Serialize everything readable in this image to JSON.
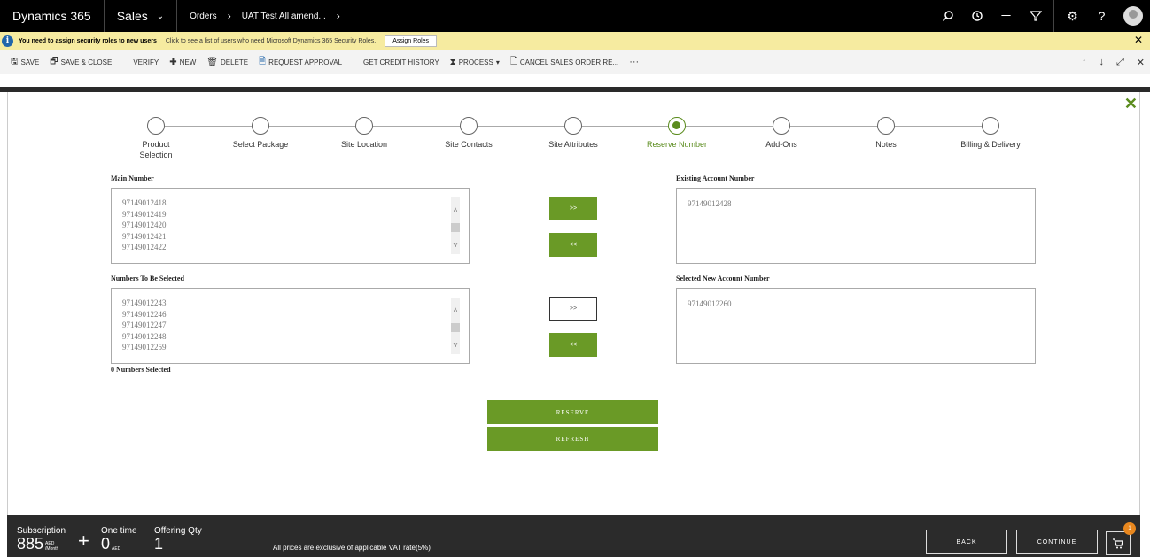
{
  "nav": {
    "brand": "Dynamics 365",
    "app": "Sales",
    "breadcrumb": [
      "Orders",
      "UAT Test All amend..."
    ]
  },
  "notification": {
    "title": "You need to assign security roles to new users",
    "message": "Click to see a list of users who need Microsoft Dynamics 365 Security Roles.",
    "button": "Assign Roles"
  },
  "commands": [
    {
      "label": "SAVE",
      "icon": "save-icon"
    },
    {
      "label": "SAVE & CLOSE",
      "icon": "save-close-icon"
    },
    {
      "label": "VERIFY",
      "icon": ""
    },
    {
      "label": "NEW",
      "icon": "plus-icon"
    },
    {
      "label": "DELETE",
      "icon": "trash-icon"
    },
    {
      "label": "REQUEST APPROVAL",
      "icon": "document-icon"
    },
    {
      "label": "GET CREDIT HISTORY",
      "icon": ""
    },
    {
      "label": "PROCESS",
      "icon": "process-icon"
    },
    {
      "label": "CANCEL SALES ORDER RE...",
      "icon": "cancel-doc-icon"
    }
  ],
  "steps": [
    {
      "label": "Product Selection",
      "active": false
    },
    {
      "label": "Select Package",
      "active": false
    },
    {
      "label": "Site Location",
      "active": false
    },
    {
      "label": "Site Contacts",
      "active": false
    },
    {
      "label": "Site Attributes",
      "active": false
    },
    {
      "label": "Reserve Number",
      "active": true
    },
    {
      "label": "Add-Ons",
      "active": false
    },
    {
      "label": "Notes",
      "active": false
    },
    {
      "label": "Billing & Delivery",
      "active": false
    }
  ],
  "main_number": {
    "label": "Main Number",
    "items": [
      "97149012418",
      "97149012419",
      "97149012420",
      "97149012421",
      "97149012422"
    ]
  },
  "existing_account": {
    "label": "Existing Account Number",
    "value": "97149012428"
  },
  "numbers_to_select": {
    "label": "Numbers To Be Selected",
    "items": [
      "97149012243",
      "97149012246",
      "97149012247",
      "97149012248",
      "97149012259"
    ],
    "count_label": "0 Numbers Selected"
  },
  "selected_new_account": {
    "label": "Selected New Account Number",
    "value": "97149012260"
  },
  "arrows": {
    "right": ">>",
    "left": "<<"
  },
  "actions": {
    "reserve": "RESERVE",
    "refresh": "REFRESH"
  },
  "footer": {
    "subscription_label": "Subscription",
    "subscription_value": "885",
    "subscription_unit_1": "AED",
    "subscription_unit_2": "/Month",
    "onetime_label": "One time",
    "onetime_value": "0",
    "onetime_unit": "AED",
    "qty_label": "Offering Qty",
    "qty_value": "1",
    "vat_note": "All prices are exclusive of applicable VAT rate(5%)",
    "back": "BACK",
    "continue": "CONTINUE",
    "cart_count": "1"
  },
  "colors": {
    "accent": "#6a9a26",
    "active_step": "#5b8c1e",
    "notification": "#f6eba0"
  }
}
